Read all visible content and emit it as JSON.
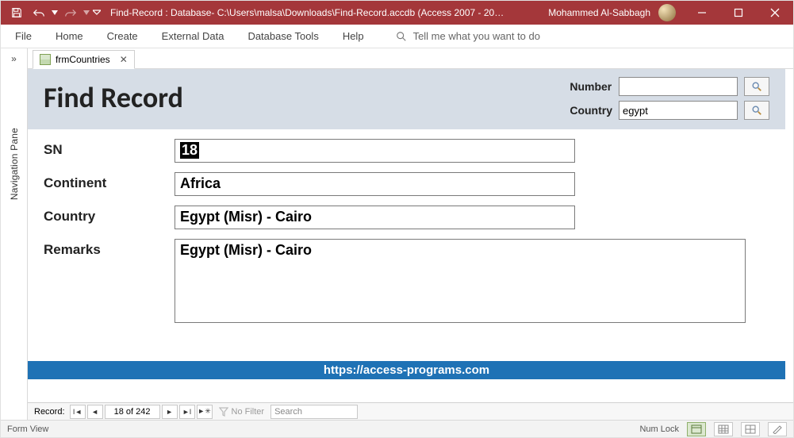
{
  "titlebar": {
    "title": "Find-Record : Database- C:\\Users\\malsa\\Downloads\\Find-Record.accdb (Access 2007 - 20…",
    "user": "Mohammed Al-Sabbagh"
  },
  "ribbon": {
    "file": "File",
    "home": "Home",
    "create": "Create",
    "external": "External Data",
    "dbtools": "Database Tools",
    "help": "Help",
    "tellme": "Tell me what you want to do"
  },
  "navpane": {
    "label": "Navigation Pane"
  },
  "doctab": {
    "name": "frmCountries"
  },
  "form": {
    "title": "Find Record",
    "search": {
      "number_label": "Number",
      "number_value": "",
      "country_label": "Country",
      "country_value": "egypt"
    },
    "fields": {
      "sn_label": "SN",
      "sn_value": "18",
      "continent_label": "Continent",
      "continent_value": "Africa",
      "country_label": "Country",
      "country_value": "Egypt (Misr) - Cairo",
      "remarks_label": "Remarks",
      "remarks_value": "Egypt (Misr) - Cairo"
    },
    "footer_link": "https://access-programs.com"
  },
  "recnav": {
    "label": "Record:",
    "counter": "18 of 242",
    "filter": "No Filter",
    "search_placeholder": "Search"
  },
  "statusbar": {
    "left": "Form View",
    "numlock": "Num Lock"
  }
}
